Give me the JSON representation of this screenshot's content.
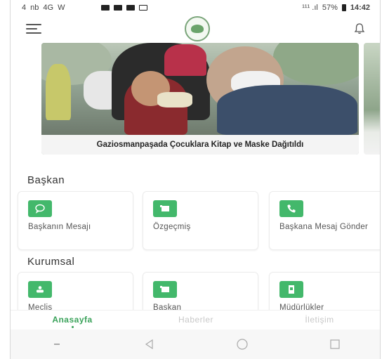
{
  "status_bar": {
    "left_items": [
      "4",
      "nb",
      "4G",
      "W"
    ],
    "network": "¹¹¹ .ıl",
    "battery": "57%",
    "time": "14:42"
  },
  "header": {
    "menu_icon": "hamburger-icon",
    "logo_icon": "municipality-logo",
    "notification_icon": "bell-icon"
  },
  "carousel": {
    "caption": "Gaziosmanpaşada Çocuklara Kitap ve Maske Dağıtıldı"
  },
  "sections": [
    {
      "title": "Başkan",
      "items": [
        {
          "label": "Başkanın Mesajı",
          "icon": "chat-bubble-icon"
        },
        {
          "label": "Özgeçmiş",
          "icon": "document-icon"
        },
        {
          "label": "Başkana Mesaj Gönder",
          "icon": "phone-icon"
        }
      ]
    },
    {
      "title": "Kurumsal",
      "items": [
        {
          "label": "Meclis",
          "icon": "assembly-icon"
        },
        {
          "label": "Başkan",
          "icon": "document-icon"
        },
        {
          "label": "Müdürlükler",
          "icon": "building-icon"
        }
      ]
    }
  ],
  "tabs": [
    {
      "label": "Anasayfa",
      "active": true
    },
    {
      "label": "Haberler",
      "active": false
    },
    {
      "label": "İletişim",
      "active": false
    }
  ],
  "colors": {
    "accent": "#43b86b",
    "active_tab": "#3aa25a"
  }
}
